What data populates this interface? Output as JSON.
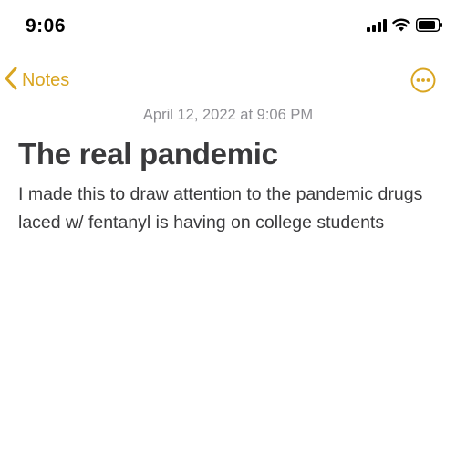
{
  "status_bar": {
    "time": "9:06",
    "icons": [
      "signal-icon",
      "wifi-icon",
      "battery-icon"
    ]
  },
  "nav": {
    "back_label": "Notes",
    "back_icon": "chevron-left-icon",
    "more_icon": "ellipsis-circle-icon",
    "accent_color": "#d9a521"
  },
  "note": {
    "date": "April 12, 2022 at 9:06 PM",
    "title": "The real pandemic",
    "body": "I made this to draw attention to the pandemic drugs laced w/ fentanyl is having on college students"
  }
}
